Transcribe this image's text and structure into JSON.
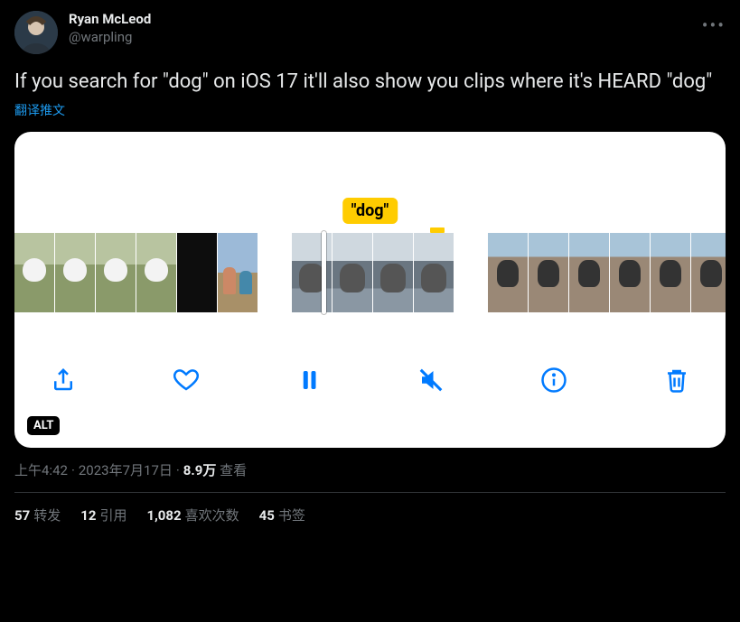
{
  "author": {
    "display_name": "Ryan McLeod",
    "handle": "@warpling"
  },
  "tweet_text": "If you search for \"dog\" on iOS 17 it'll also show you clips where it's HEARD \"dog\"",
  "translate_label": "翻译推文",
  "media": {
    "caption_text": "\"dog\"",
    "alt_badge": "ALT"
  },
  "meta": {
    "time": "上午4:42",
    "date": "2023年7月17日",
    "views_count": "8.9万",
    "views_label": "查看"
  },
  "stats": {
    "retweets_n": "57",
    "retweets_label": "转发",
    "quotes_n": "12",
    "quotes_label": "引用",
    "likes_n": "1,082",
    "likes_label": "喜欢次数",
    "bookmarks_n": "45",
    "bookmarks_label": "书签"
  }
}
